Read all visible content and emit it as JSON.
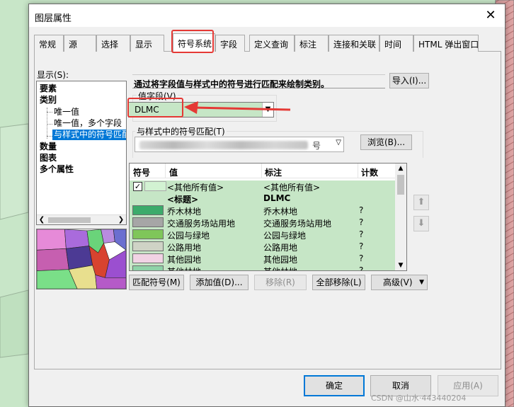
{
  "dialog": {
    "title": "图层属性",
    "close_glyph": "✕"
  },
  "tabs": [
    "常规",
    "源",
    "选择",
    "显示",
    "符号系统",
    "字段",
    "定义查询",
    "标注",
    "连接和关联",
    "时间",
    "HTML 弹出窗口"
  ],
  "active_tab": "符号系统",
  "left": {
    "show_label": "显示(S):",
    "tree": {
      "features": "要素",
      "categories": "类别",
      "unique_value": "唯一值",
      "unique_value_many": "唯一值，多个字段",
      "match_style": "与样式中的符号匹配",
      "quantities": "数量",
      "charts": "图表",
      "multi_attr": "多个属性"
    }
  },
  "right": {
    "description": "通过将字段值与样式中的符号进行匹配来绘制类别。",
    "import_button": "导入(I)...",
    "value_field_label": "值字段(V)",
    "value_field_value": "DLMC",
    "match_style_label": "与样式中的符号匹配(T)",
    "style_value_suffix": "号",
    "browse_button": "浏览(B)...",
    "table": {
      "headers": {
        "symbol": "符号",
        "value": "值",
        "label": "标注",
        "count": "计数"
      },
      "all_other": {
        "value": "<其他所有值>",
        "label": "<其他所有值>",
        "swatch_color": "#d2f2d2"
      },
      "heading": {
        "value": "<标题>",
        "label": "DLMC"
      },
      "rows": [
        {
          "value": "乔木林地",
          "label": "乔木林地",
          "count": "?",
          "color": "#3cab6b"
        },
        {
          "value": "交通服务场站用地",
          "label": "交通服务场站用地",
          "count": "?",
          "color": "#a6a6a6"
        },
        {
          "value": "公园与绿地",
          "label": "公园与绿地",
          "count": "?",
          "color": "#7fc65a"
        },
        {
          "value": "公路用地",
          "label": "公路用地",
          "count": "?",
          "color": "#cfd3c6"
        },
        {
          "value": "其他园地",
          "label": "其他园地",
          "count": "?",
          "color": "#f1d3e4"
        },
        {
          "value": "其他林地",
          "label": "其他林地",
          "count": "?",
          "color": "#8fd3a8"
        }
      ]
    },
    "buttons": {
      "match_symbols": "匹配符号(M)",
      "add_values": "添加值(D)...",
      "remove": "移除(R)",
      "remove_all": "全部移除(L)",
      "advanced": "高级(V)"
    }
  },
  "footer": {
    "ok": "确定",
    "cancel": "取消",
    "apply": "应用(A)"
  },
  "watermark": "CSDN @山水·443440204"
}
